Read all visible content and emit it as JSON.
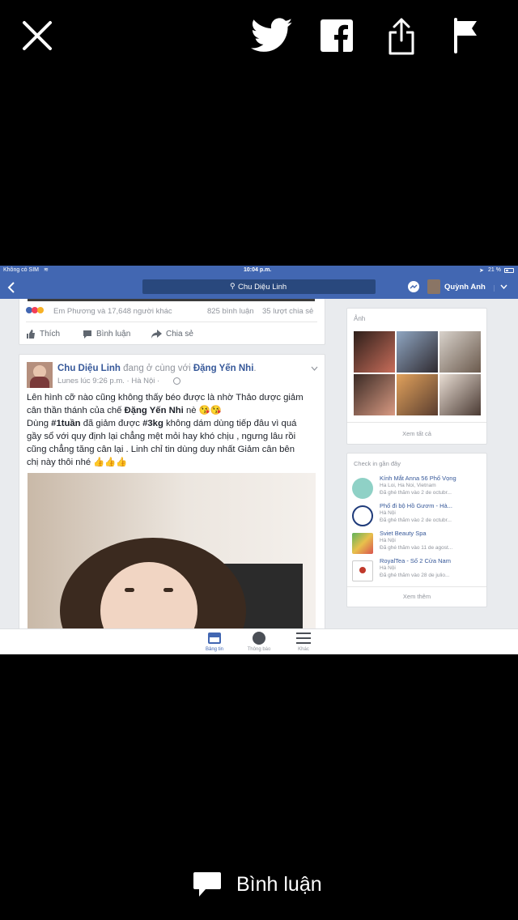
{
  "toolbar": {
    "icons": [
      "close-icon",
      "twitter-icon",
      "facebook-icon",
      "share-icon",
      "flag-icon"
    ]
  },
  "screenshot": {
    "status": {
      "carrier": "Không có SIM",
      "time": "10:04 p.m.",
      "battery": "21 %"
    },
    "nav": {
      "search_text": "Chu Diệu Linh",
      "user_name": "Quỳnh Anh"
    },
    "prev_post": {
      "reactions": "Em Phương và 17,648 người khác",
      "comments": "825 bình luận",
      "shares": "35 lượt chia sẻ",
      "like": "Thích",
      "comment": "Bình luận",
      "share": "Chia sẻ"
    },
    "post": {
      "author": "Chu Diệu Linh",
      "with_text": "đang ở cùng với",
      "tagged": "Đặng Yến Nhi",
      "time": "Lunes lúc 9:26 p.m. · Hà Nội ·",
      "line1": "Lên hình cỡ nào cũng không thấy béo được là nhờ Thảo dược giảm",
      "line2a": "cân thần thánh của chế ",
      "line2b": "Đặng Yến Nhi",
      "line2c": " nè 😘😘",
      "line3a": "Dùng ",
      "line3b": "#1tuần",
      "line3c": " đã giảm được ",
      "line3d": "#3kg",
      "line3e": " không dám dùng tiếp đâu vì quá",
      "line4": "gầy sổ với quy định lại chẳng mệt mỏi hay khó chịu , ngưng lâu rồi",
      "line5": "cũng chẳng tăng cân lại . Linh chỉ tin dùng duy nhất Giảm cân bên",
      "line6": "chị này thôi nhé 👍👍👍"
    },
    "photos": {
      "title": "Ảnh",
      "see_all": "Xem tất cả"
    },
    "checkins": {
      "title": "Check in gần đây",
      "items": [
        {
          "name": "Kính Mắt Anna 56 Phố Vọng",
          "line2": "Ha Loi, Ha Noi, Vietnam",
          "line3": "Đã ghé thăm vào 2 de octubr..."
        },
        {
          "name": "Phố đi bộ Hồ Gươm - Hà...",
          "line2": "Hà Nội",
          "line3": "Đã ghé thăm vào 2 de octubr..."
        },
        {
          "name": "Sviet Beauty Spa",
          "line2": "Hà Nội",
          "line3": "Đã ghé thăm vào 11 de agost..."
        },
        {
          "name": "RoyalTea - Số 2 Cửa Nam",
          "line2": "Hà Nội",
          "line3": "Đã ghé thăm vào 28 de julio..."
        }
      ],
      "see_more": "Xem thêm"
    },
    "tabs": [
      "Bảng tin",
      "Thông báo",
      "Khác"
    ],
    "colors": {
      "fb_blue": "#4267b2",
      "link": "#365899"
    }
  },
  "footer": {
    "comment_label": "Bình luận"
  }
}
